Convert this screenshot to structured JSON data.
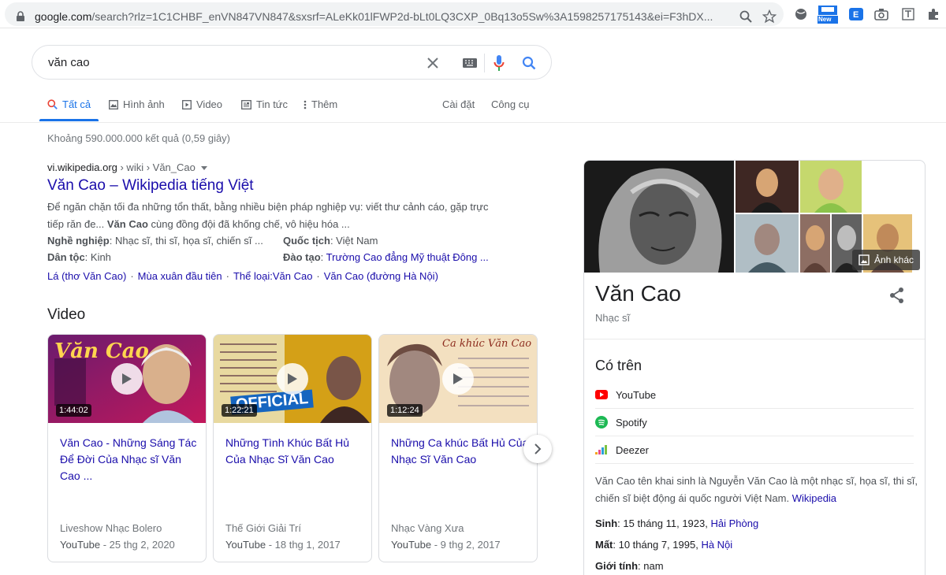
{
  "browser": {
    "url_host": "google.com",
    "url_rest": "/search?rlz=1C1CHBF_enVN847VN847&sxsrf=ALeKk01lFWP2d-bLt0LQ3CXP_0Bq13o5Sw%3A1598257175143&ei=F3hDX...",
    "badge_label": "New"
  },
  "search": {
    "query": "văn cao"
  },
  "tabs": [
    {
      "label": "Tất cả"
    },
    {
      "label": "Hình ảnh"
    },
    {
      "label": "Video"
    },
    {
      "label": "Tin tức"
    },
    {
      "label": "Thêm"
    }
  ],
  "tools": {
    "settings": "Cài đặt",
    "tools": "Công cụ"
  },
  "result_stats": "Khoảng 590.000.000 kết quả (0,59 giây)",
  "wiki_result": {
    "cite_host": "vi.wikipedia.org",
    "cite_path": " › wiki › Văn_Cao",
    "title": "Văn Cao – Wikipedia tiếng Việt",
    "snippet_1": "Để ngăn chặn tối đa những tổn thất, bằng nhiều biện pháp nghiệp vụ: viết thư cảnh cáo, gặp trực tiếp răn đe... ",
    "snippet_bold": "Văn Cao",
    "snippet_2": " cùng đồng đội đã khống chế, vô hiệu hóa ...",
    "facts": {
      "occupation_label": "Nghề nghiệp",
      "occupation_value": ": Nhạc sĩ, thi sĩ, họa sĩ, chiến sĩ ...",
      "ethnicity_label": "Dân tộc",
      "ethnicity_value": ": Kinh",
      "nationality_label": "Quốc tịch",
      "nationality_value": ": Việt Nam",
      "education_label": "Đào tạo",
      "education_sep": ": ",
      "education_value": "Trường Cao đẳng Mỹ thuật Đông ..."
    },
    "sitelinks": [
      "Lá (thơ Văn Cao)",
      "Mùa xuân đầu tiên",
      "Thể loại:Văn Cao",
      "Văn Cao (đường Hà Nội)"
    ]
  },
  "video_section": {
    "heading": "Video",
    "videos": [
      {
        "title": "Văn Cao - Những Sáng Tác Để Đời Của Nhạc sĩ Văn Cao ...",
        "duration": "1:44:02",
        "source": "Liveshow Nhạc Bolero",
        "platform": "YouTube",
        "date": " - 25 thg 2, 2020",
        "thumb_text": "Văn Cao"
      },
      {
        "title": "Những Tình Khúc Bất Hủ Của Nhạc Sĩ Văn Cao",
        "duration": "1:22:21",
        "source": "Thế Giới Giải Trí",
        "platform": "YouTube",
        "date": " - 18 thg 1, 2017",
        "thumb_text": "OFFICIAL"
      },
      {
        "title": "Những Ca khúc Bất Hủ Của Nhạc Sĩ Văn Cao",
        "duration": "1:12:24",
        "source": "Nhạc Vàng Xưa",
        "platform": "YouTube",
        "date": " - 9 thg 2, 2017",
        "thumb_text": "Ca khúc Văn Cao"
      }
    ]
  },
  "knowledge_panel": {
    "more_images": "Ảnh khác",
    "title": "Văn Cao",
    "subtitle": "Nhạc sĩ",
    "available_on_heading": "Có trên",
    "platforms": [
      "YouTube",
      "Spotify",
      "Deezer"
    ],
    "description": "Văn Cao tên khai sinh là Nguyễn Văn Cao là một nhạc sĩ, họa sĩ, thi sĩ, chiến sĩ biệt động ái quốc người Việt Nam. ",
    "description_link": "Wikipedia",
    "born_label": "Sinh",
    "born_value": ": 15 tháng 11, 1923, ",
    "born_place": "Hải Phòng",
    "died_label": "Mất",
    "died_value": ": 10 tháng 7, 1995, ",
    "died_place": "Hà Nội",
    "gender_label": "Giới tính",
    "gender_value": ": nam"
  },
  "colors": {
    "link": "#1a0dab",
    "accent": "#1a73e8",
    "youtube": "#ff0000",
    "spotify": "#1db954"
  }
}
